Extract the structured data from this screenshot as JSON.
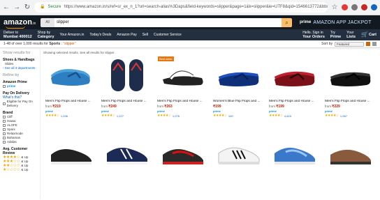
{
  "browser": {
    "url_prefix": "Secure",
    "url": "https://www.amazon.in/s/ref=sr_ex_n_1?url=search-alias%3Daps&field-keywords=slipper&page=1&k=slipper&ie=UTF8&qid=1546613772&bbn=spr"
  },
  "header": {
    "logo": "amazon",
    "logo_suffix": ".in",
    "search_category": "All",
    "search_value": "slipper",
    "prime_label": "prime",
    "promo_text": "AMAZON APP JACKPOT",
    "deliver_line1": "Deliver to",
    "deliver_line2": "Mumbai 400012",
    "shop_by_line1": "Shop by",
    "shop_by_line2": "Category",
    "nav_links": [
      "Your Amazon.in",
      "Today's Deals",
      "Amazon Pay",
      "Sell",
      "Customer Service"
    ],
    "account_line1": "Hello. Sign in",
    "account_line2": "Your Orders",
    "try_line1": "Try",
    "try_line2": "Prime",
    "lists_line1": "Your",
    "lists_line2": "Lists",
    "cart_label": "Cart"
  },
  "results_bar": {
    "count_text": "1-48 of over 1,000 results for",
    "scope": "Sports",
    "query": "\"slipper\"",
    "sort_label": "Sort by",
    "sort_value": "Featured"
  },
  "sidebar": {
    "show_results_for": "Show results for",
    "cat_title": "Shoes & Handbags",
    "cat_sub": "Slides",
    "see_all": "See all 3 departments",
    "refine_by": "Refine by",
    "prime_title": "Amazon Prime",
    "prime_opt": "prime",
    "pod_title": "Pay On Delivery",
    "pod_link": "What's this?",
    "pod_opt": "Eligible for Pay On Delivery",
    "brand_title": "Brand",
    "brands": [
      "Cliff",
      "Hawai",
      "ALOFE",
      "Sparx",
      "Relaxmode",
      "Bahamas",
      "Adidas"
    ],
    "review_title": "Avg. Customer Review",
    "reviews": [
      "& Up",
      "& Up",
      "& Up",
      "& Up"
    ]
  },
  "grid": {
    "header": "Showing selected results. See all results for slipper."
  },
  "products": [
    {
      "title": "Men's Flip Flops and House ...",
      "price_prefix": "from",
      "price": "₹219",
      "suffix": "prime",
      "reviews": "1,036",
      "badge": ""
    },
    {
      "title": "Men's Flip Flops and House ...",
      "price_prefix": "from",
      "price": "₹249",
      "suffix": "prime",
      "reviews": "1,227",
      "badge": ""
    },
    {
      "title": "Men's Flip Flops and House ...",
      "price_prefix": "from",
      "price": "₹263",
      "suffix": "prime",
      "reviews": "1,076",
      "badge": "Best seller"
    },
    {
      "title": "Women's Blue Flip Flops and ...",
      "price_prefix": "",
      "price": "₹199",
      "suffix": "prime",
      "reviews": "100",
      "badge": ""
    },
    {
      "title": "Men's Flip Flops and House ...",
      "price_prefix": "from",
      "price": "₹199",
      "suffix": "prime",
      "reviews": "4,824",
      "badge": ""
    },
    {
      "title": "Men's Flip Flops and House ...",
      "price_prefix": "from",
      "price": "₹229",
      "suffix": "prime",
      "reviews": "1,067",
      "badge": ""
    }
  ],
  "colors": {
    "amazon_dark": "#131921",
    "amazon_nav": "#232f3e",
    "search_button": "#febd69",
    "accent": "#f90",
    "price": "#b12704",
    "star": "#f0a500"
  }
}
